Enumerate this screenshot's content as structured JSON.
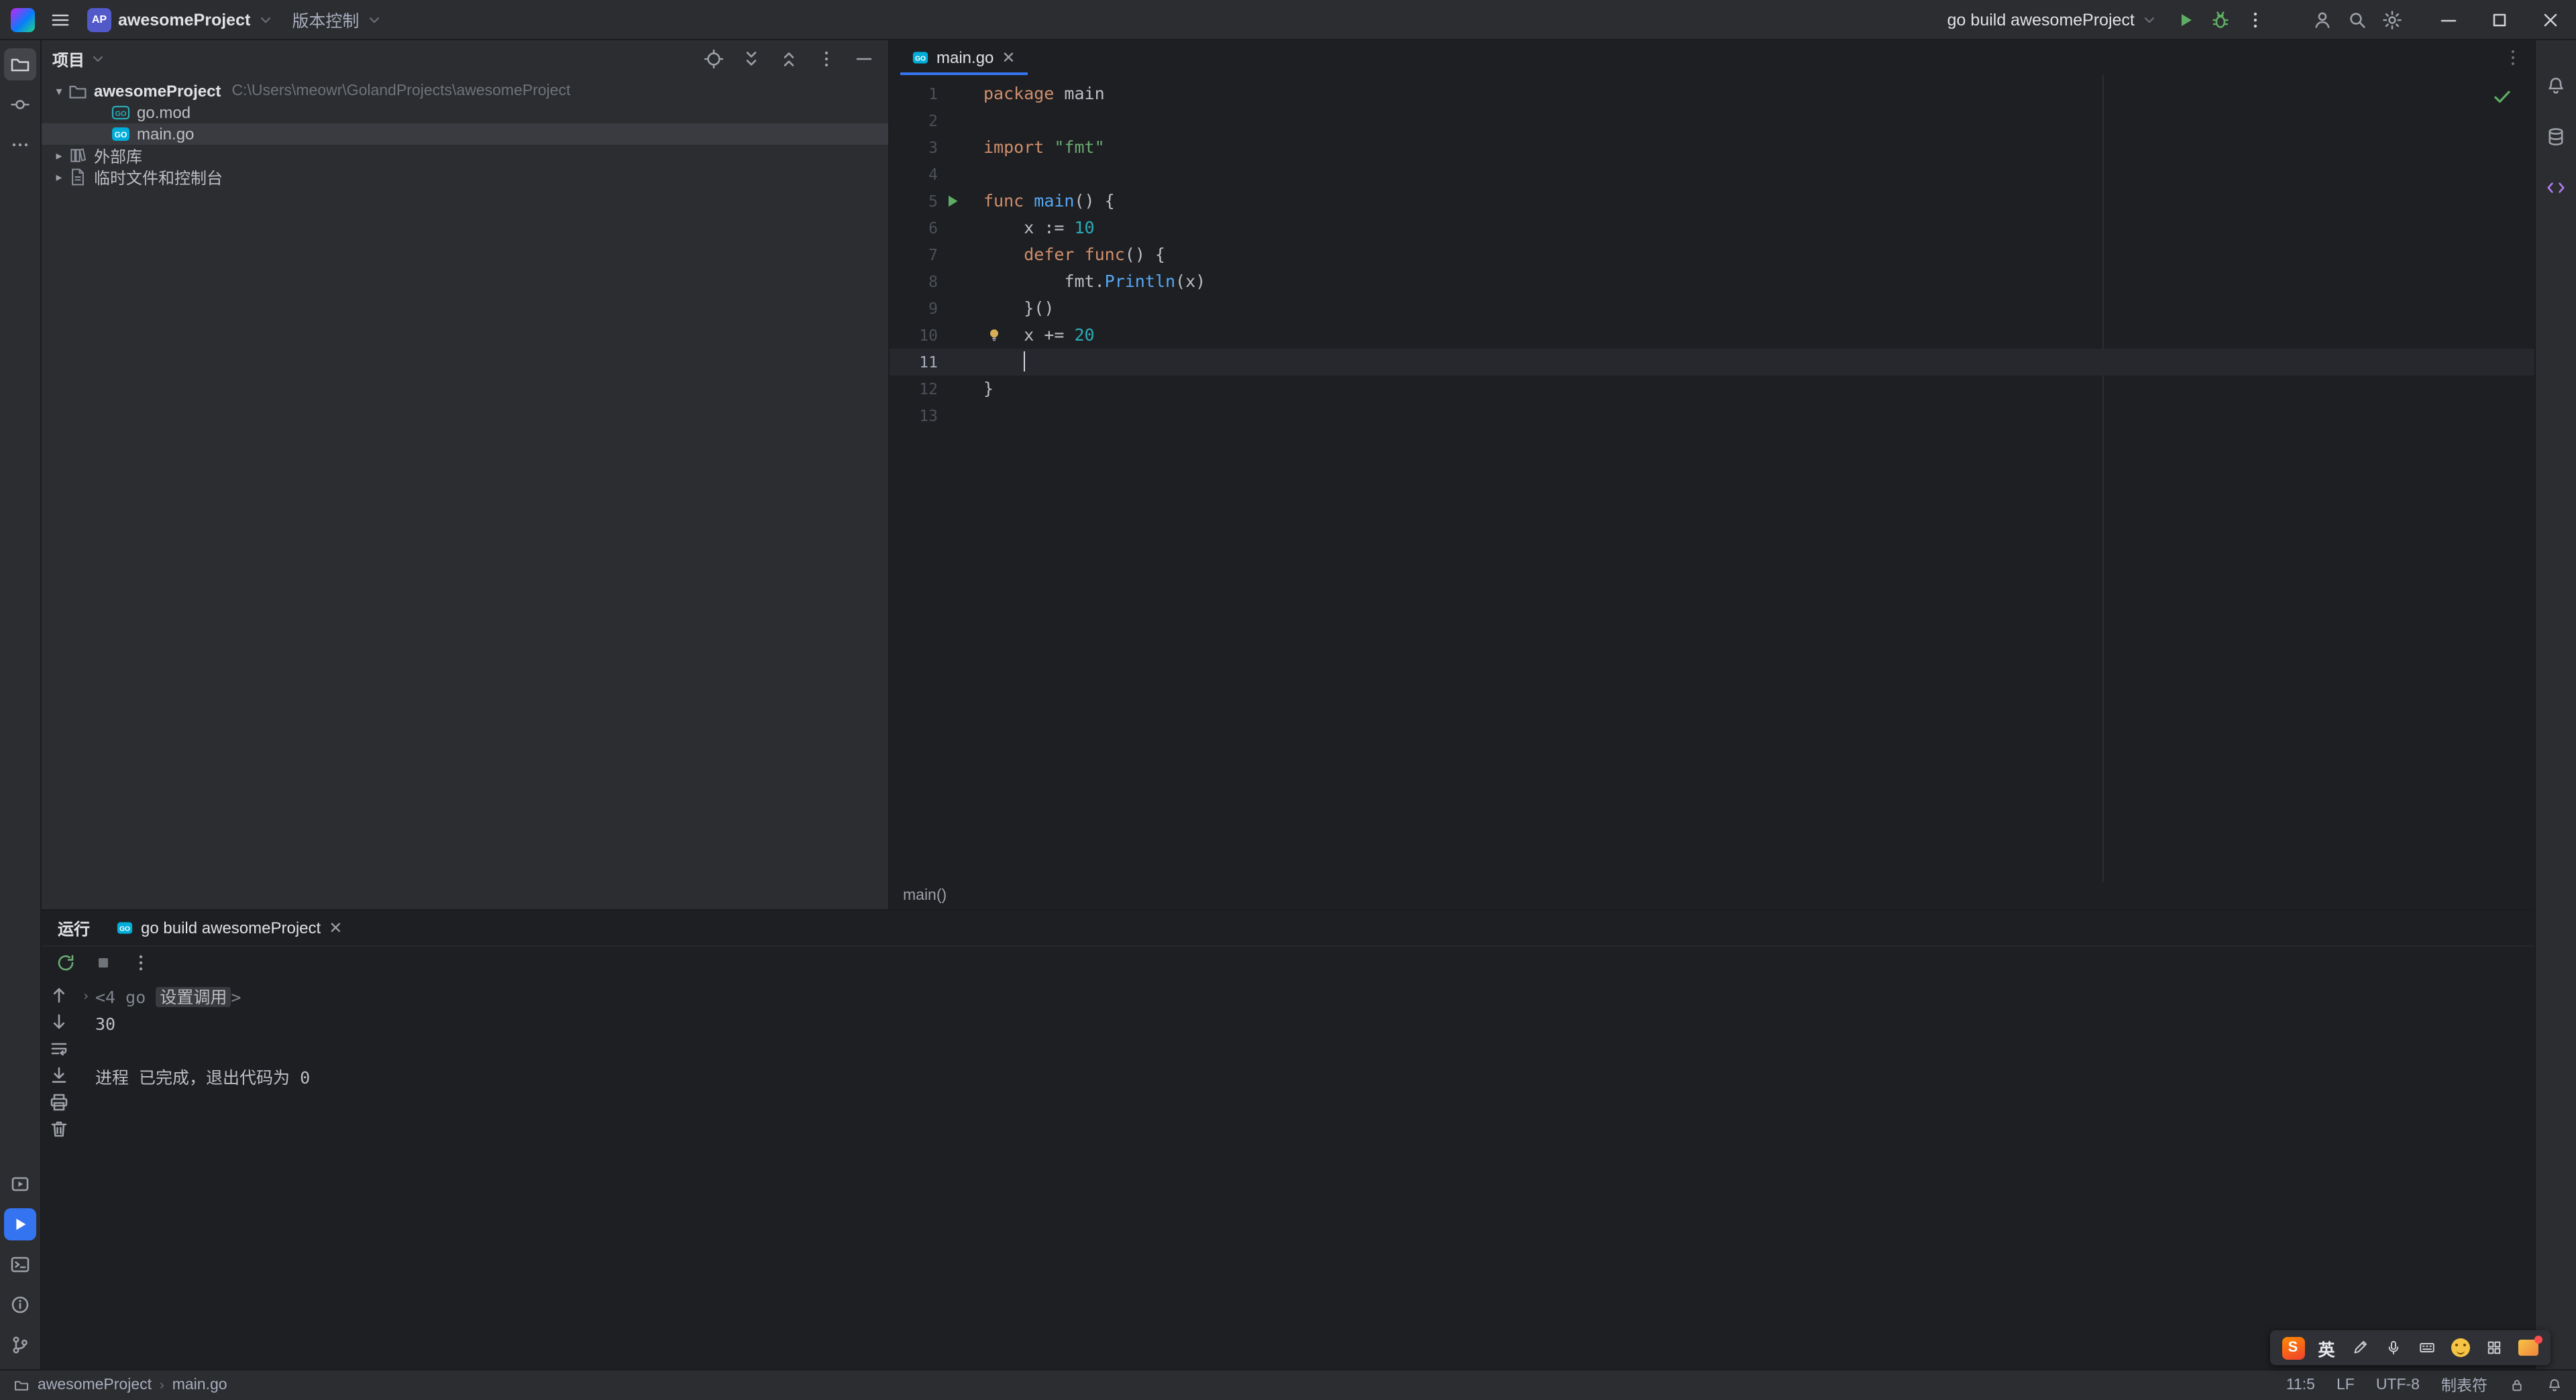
{
  "titlebar": {
    "project_badge": "AP",
    "project_name": "awesomeProject",
    "vcs_label": "版本控制",
    "run_config": "go build awesomeProject"
  },
  "project_panel": {
    "title": "项目",
    "tree": [
      {
        "level": 0,
        "chevron": "down",
        "icon": "folder",
        "label": "awesomeProject",
        "sub": "C:\\Users\\meowr\\GolandProjects\\awesomeProject",
        "selected": false,
        "root": true
      },
      {
        "level": 1,
        "chevron": null,
        "icon": "gomod",
        "label": "go.mod",
        "selected": false
      },
      {
        "level": 1,
        "chevron": null,
        "icon": "gofile",
        "label": "main.go",
        "selected": true
      },
      {
        "level": 0,
        "chevron": "right",
        "icon": "library",
        "label": "外部库",
        "selected": false
      },
      {
        "level": 0,
        "chevron": "right",
        "icon": "scratch",
        "label": "临时文件和控制台",
        "selected": false
      }
    ]
  },
  "editor": {
    "tab": "main.go",
    "breadcrumb": "main()",
    "lines": [
      {
        "n": 1,
        "t": [
          [
            "k",
            "package"
          ],
          [
            "p",
            " main"
          ]
        ]
      },
      {
        "n": 2,
        "t": []
      },
      {
        "n": 3,
        "t": [
          [
            "k",
            "import"
          ],
          [
            "p",
            " "
          ],
          [
            "s",
            "\"fmt\""
          ]
        ]
      },
      {
        "n": 4,
        "t": []
      },
      {
        "n": 5,
        "t": [
          [
            "k",
            "func"
          ],
          [
            "p",
            " "
          ],
          [
            "fn",
            "main"
          ],
          [
            "p",
            "() {"
          ]
        ],
        "gutter": "run"
      },
      {
        "n": 6,
        "t": [
          [
            "p",
            "\tx := "
          ],
          [
            "num",
            "10"
          ]
        ]
      },
      {
        "n": 7,
        "t": [
          [
            "p",
            "\t"
          ],
          [
            "k",
            "defer"
          ],
          [
            "p",
            " "
          ],
          [
            "k",
            "func"
          ],
          [
            "p",
            "() {"
          ]
        ]
      },
      {
        "n": 8,
        "t": [
          [
            "p",
            "\t\tfmt."
          ],
          [
            "fn",
            "Println"
          ],
          [
            "p",
            "(x)"
          ]
        ]
      },
      {
        "n": 9,
        "t": [
          [
            "p",
            "\t}()"
          ]
        ]
      },
      {
        "n": 10,
        "t": [
          [
            "p",
            "\tx += "
          ],
          [
            "num",
            "20"
          ]
        ],
        "bulb": true
      },
      {
        "n": 11,
        "t": [
          [
            "p",
            "\t"
          ]
        ],
        "caret": true,
        "current": true
      },
      {
        "n": 12,
        "t": [
          [
            "p",
            "}"
          ]
        ]
      },
      {
        "n": 13,
        "t": []
      }
    ]
  },
  "run_panel": {
    "title": "运行",
    "tab": "go build awesomeProject",
    "console": [
      {
        "expand": true,
        "parts": [
          {
            "c": "dim",
            "t": "<4 go "
          },
          {
            "c": "fold",
            "t": "设置调用"
          },
          {
            "c": "dim",
            "t": ">"
          }
        ]
      },
      {
        "parts": [
          {
            "c": "out",
            "t": "30"
          }
        ]
      },
      {
        "parts": []
      },
      {
        "parts": [
          {
            "c": "out",
            "t": "进程 已完成，退出代码为 0"
          }
        ]
      }
    ]
  },
  "status_bar": {
    "crumb_project": "awesomeProject",
    "crumb_file": "main.go",
    "caret": "11:5",
    "line_sep": "LF",
    "encoding": "UTF-8",
    "indent": "制表符"
  },
  "ime": {
    "logo": "S",
    "mode": "英"
  },
  "colors": {
    "accent_blue": "#3574F0",
    "run_green": "#5FAD65",
    "editor_bg": "#1E1F22",
    "panel_bg": "#2B2D30",
    "caret_row": "#26282E",
    "selection_inactive": "#393B40",
    "syntax_keyword": "#CF8E6D",
    "syntax_string": "#6AAB73",
    "syntax_number": "#2AACB8",
    "syntax_function": "#56A8F5",
    "syntax_text": "#BCBEC4"
  },
  "icons": {
    "tree_chevron_down": "▾",
    "tree_chevron_right": "▸",
    "console_expander": "›",
    "breadcrumb_separator": "›",
    "tab_close": "✕"
  }
}
